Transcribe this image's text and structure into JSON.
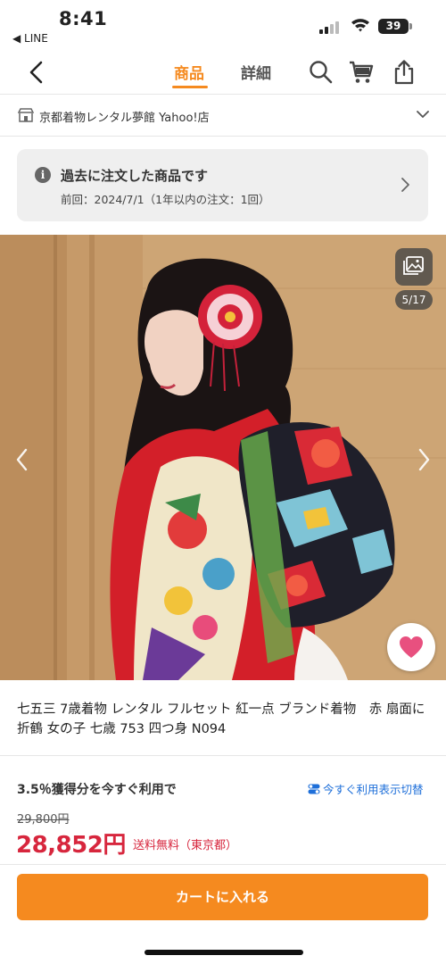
{
  "status_bar": {
    "time": "8:41",
    "back_app": "◀ LINE",
    "battery": "39"
  },
  "nav": {
    "tabs": [
      {
        "label": "商品",
        "active": true
      },
      {
        "label": "詳細",
        "active": false
      }
    ],
    "icons": [
      "back-chevron-icon",
      "search-icon",
      "cart-icon",
      "share-icon"
    ],
    "accent_color": "#f58a1f"
  },
  "store": {
    "name": "京都着物レンタル夢館 Yahoo!店"
  },
  "past_order": {
    "title": "過去に注文した商品です",
    "subtitle": "前回：2024/7/1（1年以内の注文：1回）"
  },
  "gallery": {
    "counter": "5/17"
  },
  "product": {
    "title": "七五三 7歳着物 レンタル フルセット 紅一点 ブランド着物　赤 扇面に折鶴 女の子 七歳 753 四つ身 N094"
  },
  "pricing": {
    "points_text": "3.5％獲得分を今すぐ利用で",
    "toggle_text": "今すぐ利用表示切替",
    "original_price": "29,800円",
    "price": "28,852円",
    "shipping": "送料無料（東京都）",
    "price_color": "#d7263d"
  },
  "cart": {
    "label": "カートに入れる"
  }
}
